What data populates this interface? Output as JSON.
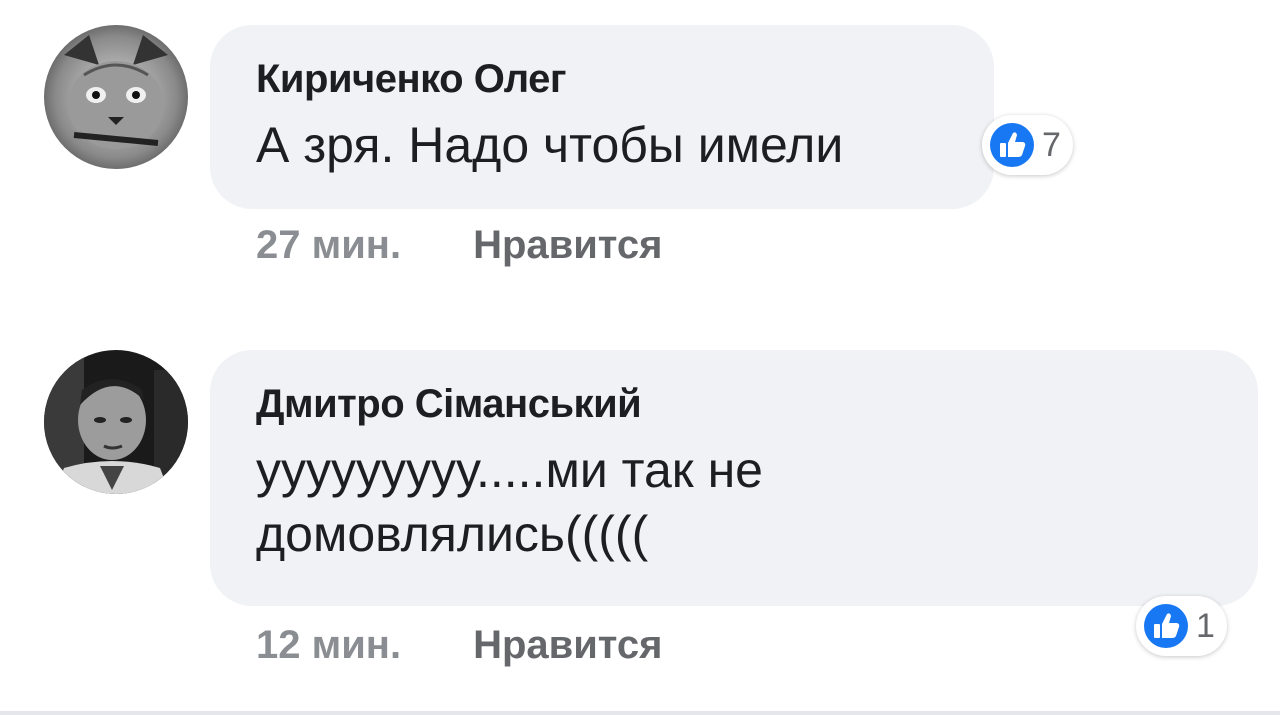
{
  "comments": [
    {
      "author": "Кириченко Олег",
      "text": "А зря. Надо чтобы имели",
      "time": "27 мин.",
      "like_label": "Нравится",
      "reaction_count": "7",
      "reaction_icon": "thumbs-up-icon"
    },
    {
      "author": "Дмитро Сіманський",
      "text_line1": "ууууууууу.....ми так не",
      "text_line2": "домовлялись(((((",
      "time": "12 мин.",
      "like_label": "Нравится",
      "reaction_count": "1",
      "reaction_icon": "thumbs-up-icon"
    }
  ],
  "colors": {
    "bubble": "#f0f2f5",
    "like_blue": "#1877f2",
    "text": "#1c1e21",
    "meta": "#65676b"
  }
}
